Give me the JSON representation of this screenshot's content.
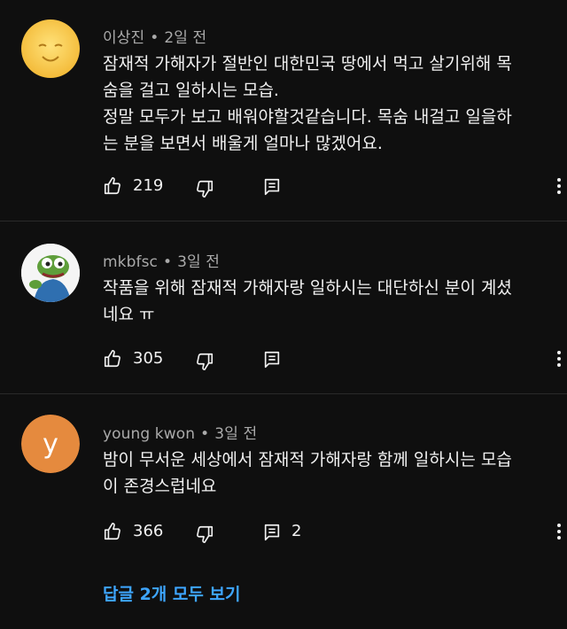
{
  "comments": [
    {
      "author": "이상진",
      "time": "2일 전",
      "lines": [
        "잠재적 가해자가 절반인 대한민국 땅에서 먹고 살기위해 목",
        "숨을 걸고 일하시는 모습.",
        "정말 모두가 보고 배워야할것같습니다. 목숨 내걸고 일을하",
        "는 분을 보면서 배울게 얼마나 많겠어요."
      ],
      "likes": "219",
      "replies": ""
    },
    {
      "author": "mkbfsc",
      "time": "3일 전",
      "lines": [
        "작품을 위해 잠재적 가해자랑 일하시는 대단하신 분이 계셨",
        "네요 ㅠ"
      ],
      "likes": "305",
      "replies": ""
    },
    {
      "author": "young kwon",
      "avatar_letter": "y",
      "time": "3일 전",
      "lines": [
        "밤이 무서운 세상에서 잠재적 가해자랑 함께 일하시는 모습",
        "이 존경스럽네요"
      ],
      "likes": "366",
      "replies": "2"
    }
  ],
  "view_replies": "답글 2개 모두 보기",
  "separator": "•",
  "icons": [
    "thumbs-up-icon",
    "thumbs-down-icon",
    "reply-icon",
    "more-vert-icon"
  ],
  "colors": {
    "background": "#0f0f0f",
    "link": "#3ea6ff",
    "meta": "#aaaaaa"
  }
}
